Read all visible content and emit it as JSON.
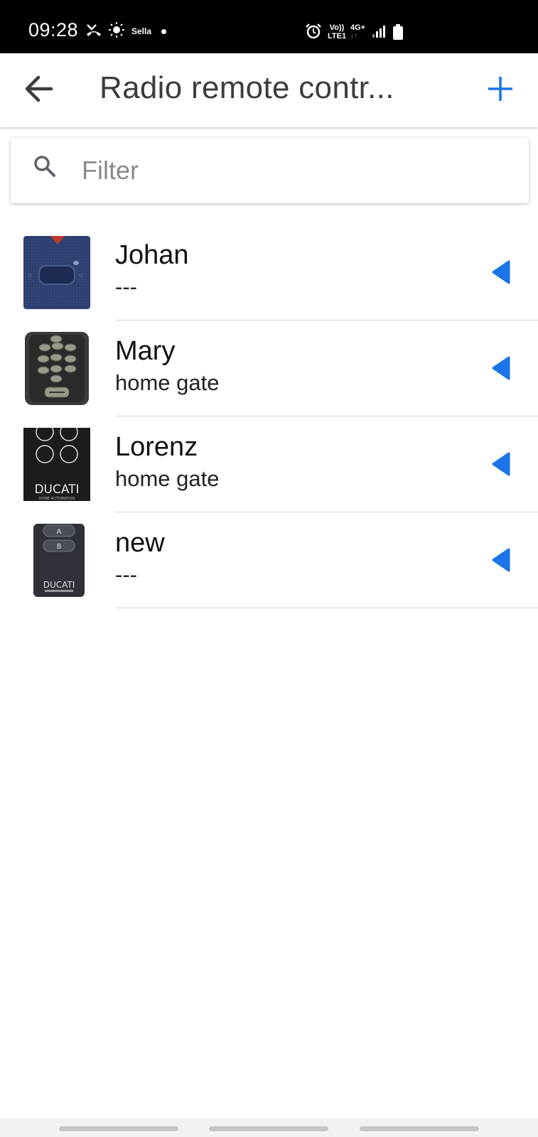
{
  "status_bar": {
    "time": "09:28",
    "carrier_label": "Sella",
    "volte_line1": "Vo))",
    "volte_line2": "LTE1",
    "network": "4G+"
  },
  "app_bar": {
    "title": "Radio remote contr...",
    "back_icon": "arrow-left-icon",
    "add_icon": "plus-icon",
    "accent_color": "#1a73e8"
  },
  "filter": {
    "placeholder": "Filter",
    "value": ""
  },
  "remotes": [
    {
      "name": "Johan",
      "subtitle": "---",
      "thumbnail": "blue-remote"
    },
    {
      "name": "Mary",
      "subtitle": "home gate",
      "thumbnail": "keypad-remote"
    },
    {
      "name": "Lorenz",
      "subtitle": "home gate",
      "thumbnail": "ducati-four-button-remote",
      "thumb_text": "DUCATI",
      "thumb_small": "HOME AUTOMATION"
    },
    {
      "name": "new",
      "subtitle": "---",
      "thumbnail": "ducati-ab-remote",
      "thumb_text": "DUCATI",
      "btn_a": "A",
      "btn_b": "B"
    }
  ]
}
